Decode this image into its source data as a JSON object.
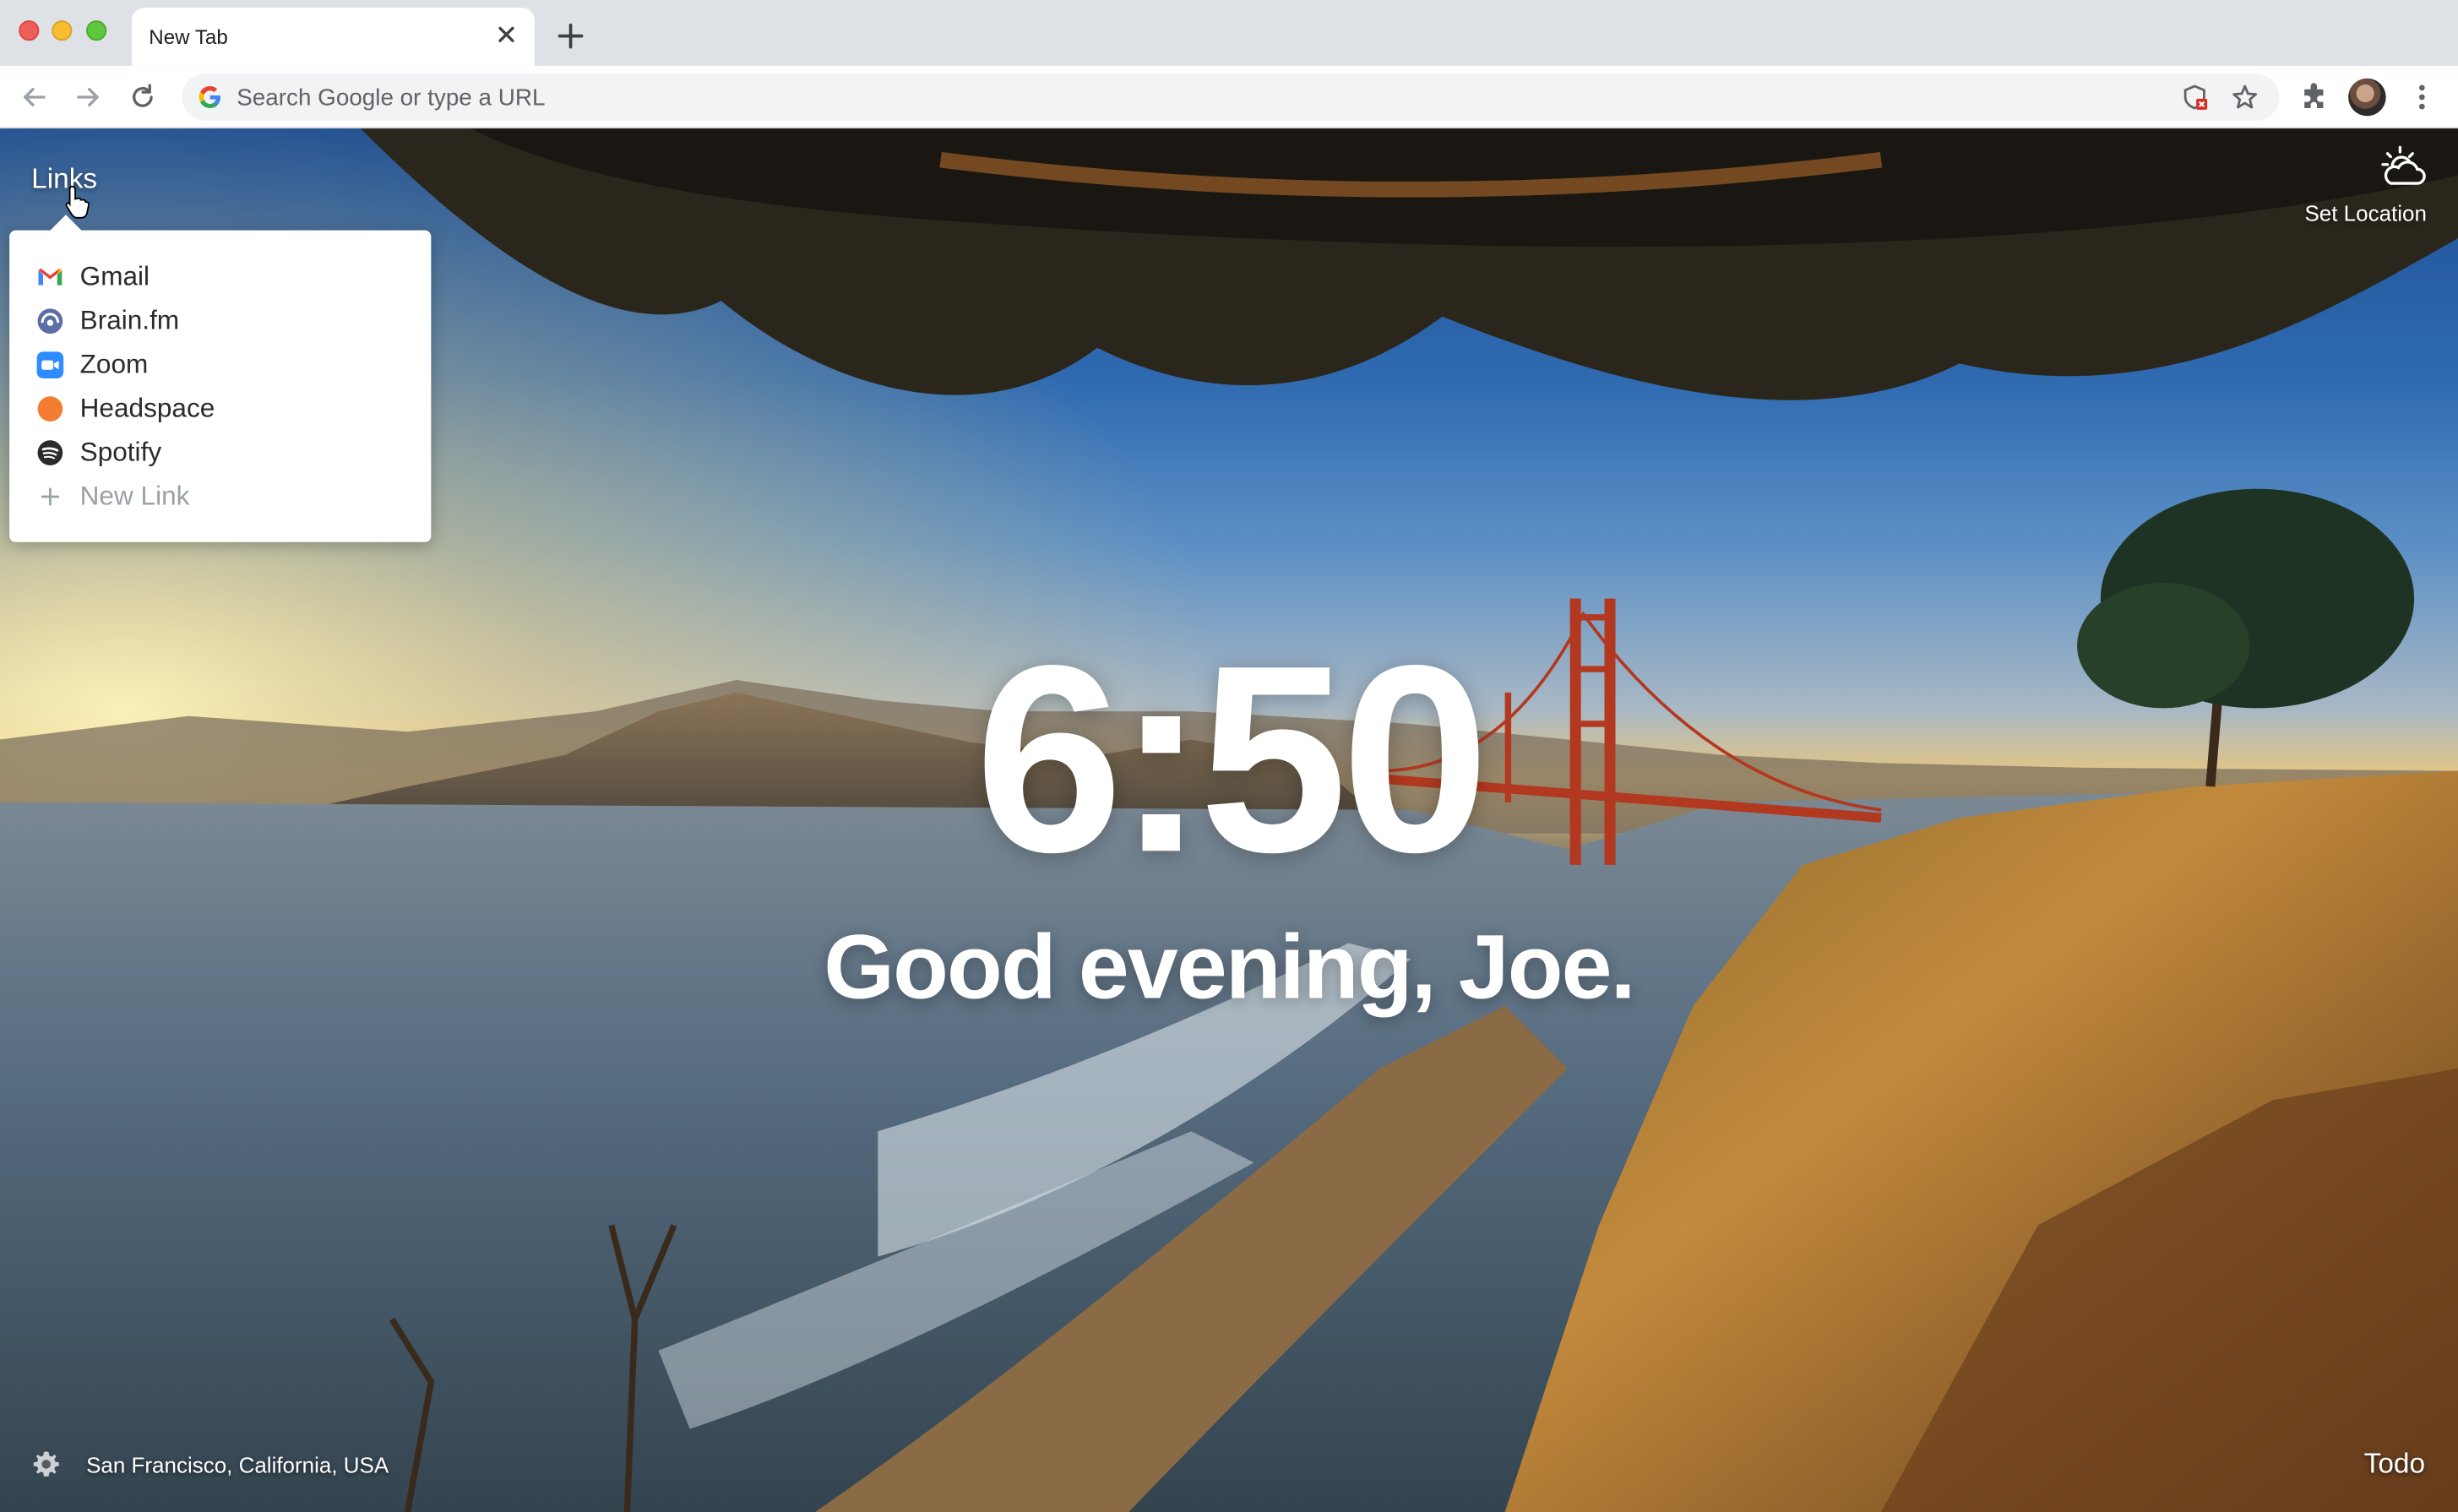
{
  "browser": {
    "tab": {
      "title": "New Tab"
    },
    "omnibox": {
      "placeholder": "Search Google or type a URL"
    },
    "icons": [
      "back-icon",
      "forward-icon",
      "reload-icon",
      "google-icon",
      "blocked-icon",
      "star-icon",
      "extensions-icon",
      "profile-avatar",
      "menu-icon"
    ]
  },
  "momentum": {
    "links": {
      "label": "Links",
      "items": [
        {
          "label": "Gmail",
          "icon": "gmail-icon"
        },
        {
          "label": "Brain.fm",
          "icon": "brainfm-icon"
        },
        {
          "label": "Zoom",
          "icon": "zoom-icon"
        },
        {
          "label": "Headspace",
          "icon": "headspace-icon"
        },
        {
          "label": "Spotify",
          "icon": "spotify-icon"
        }
      ],
      "new_link_label": "New Link"
    },
    "weather": {
      "label": "Set Location",
      "icon": "partly-cloudy-icon"
    },
    "clock": "6:50",
    "greeting": "Good evening, Joe.",
    "photo_location": "San Francisco, California, USA",
    "todo_label": "Todo"
  },
  "colors": {
    "tabstrip": "#dee1e6",
    "toolbar": "#ffffff",
    "omnibox": "#f1f3f4",
    "panel": "#ffffff",
    "text_on_photo": "#ffffff"
  }
}
